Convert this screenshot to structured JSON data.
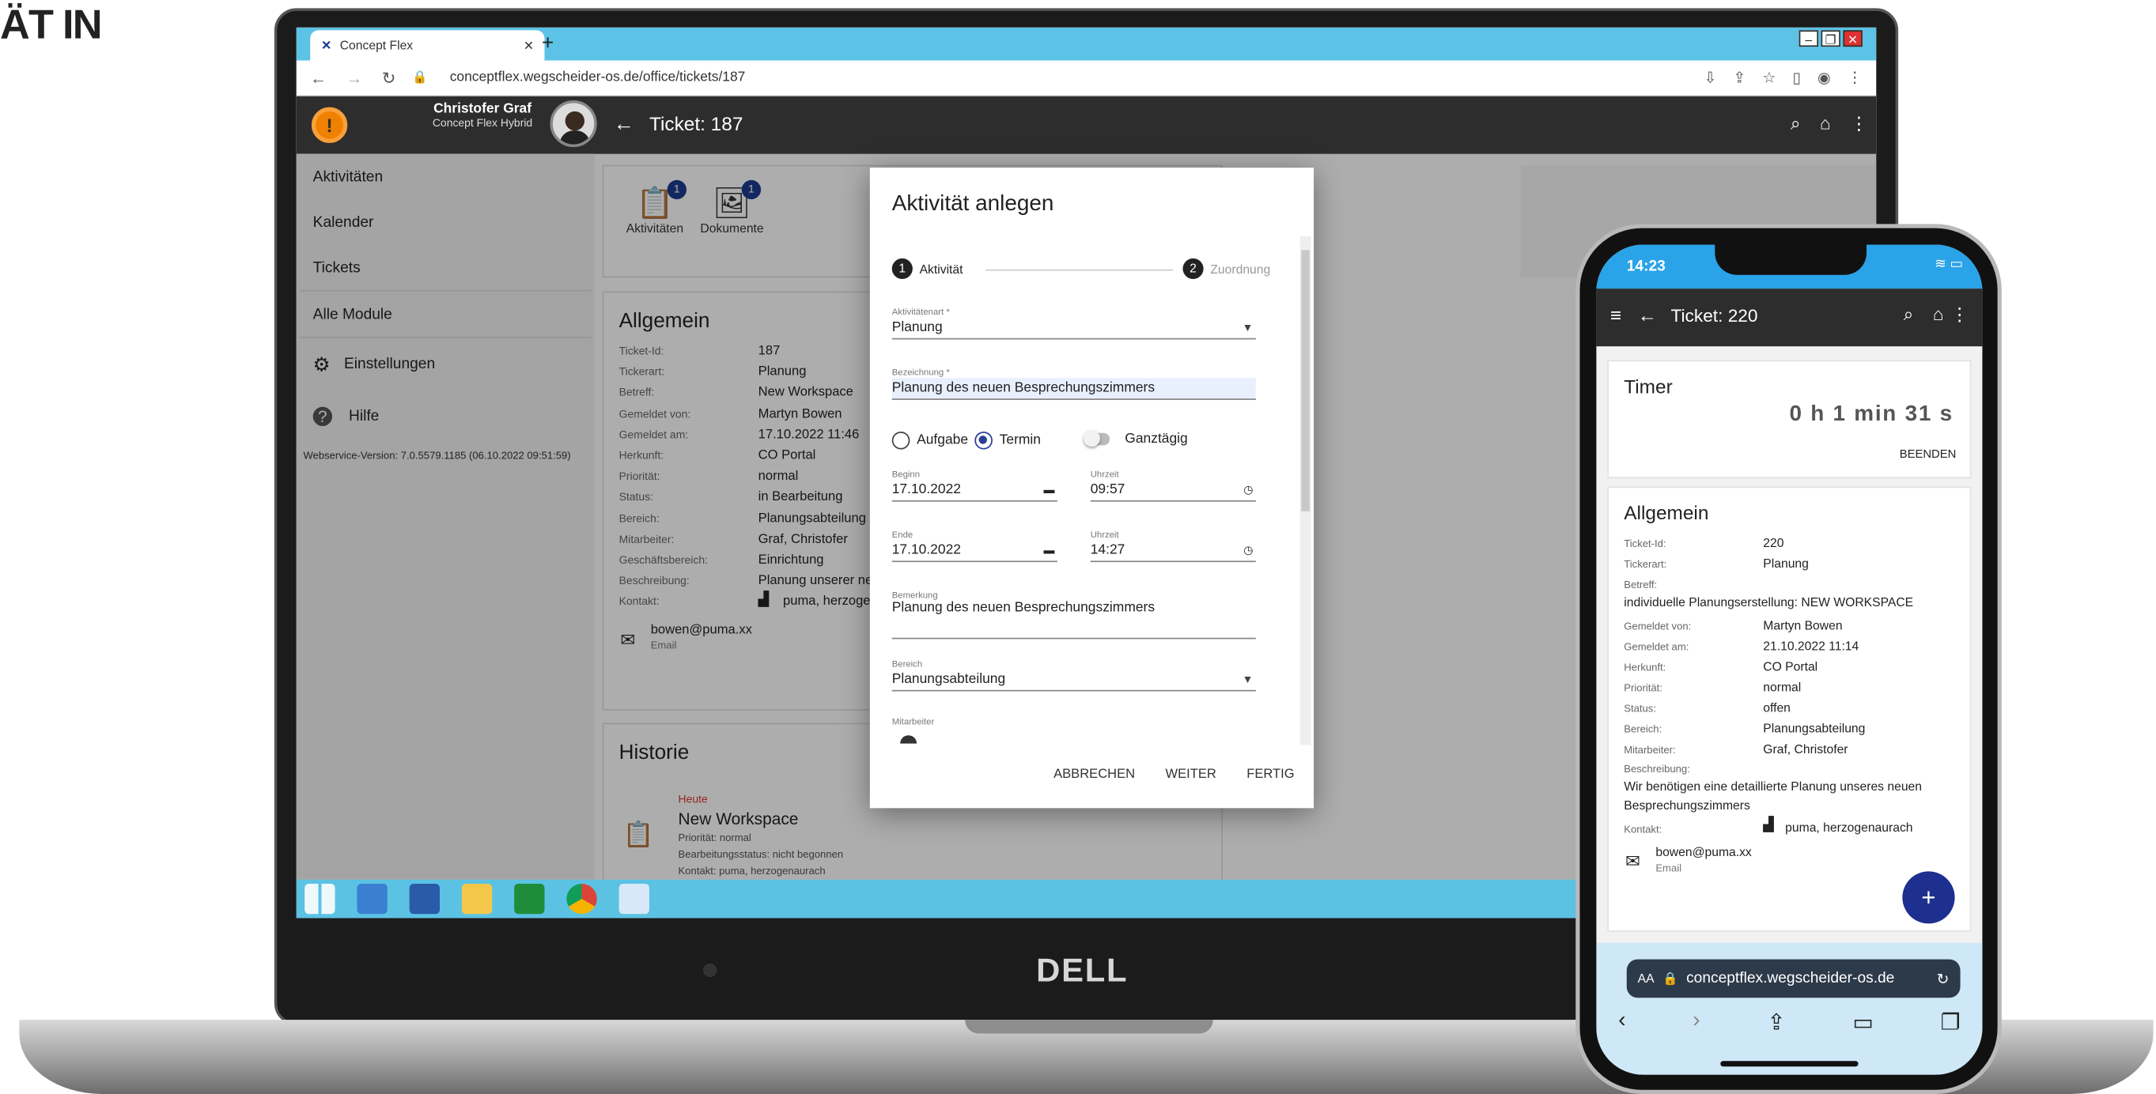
{
  "corner_text": "ÄT IN",
  "browser": {
    "tab_title": "Concept Flex",
    "url": "conceptflex.wegscheider-os.de/office/tickets/187"
  },
  "app": {
    "user_name": "Christofer Graf",
    "user_company": "Concept Flex Hybrid",
    "ticket_title": "Ticket: 187"
  },
  "sidebar": {
    "items": [
      "Aktivitäten",
      "Kalender",
      "Tickets",
      "Alle Module"
    ],
    "settings": "Einstellungen",
    "help": "Hilfe",
    "version": "Webservice-Version: 7.0.5579.1185 (06.10.2022 09:51:59)"
  },
  "chips": {
    "activities": "Aktivitäten",
    "activities_count": "1",
    "documents": "Dokumente",
    "documents_count": "1"
  },
  "general": {
    "title": "Allgemein",
    "rows": [
      {
        "k": "Ticket-Id:",
        "v": "187"
      },
      {
        "k": "Tickerart:",
        "v": "Planung"
      },
      {
        "k": "Betreff:",
        "v": "New Workspace"
      },
      {
        "k": "Gemeldet von:",
        "v": "Martyn Bowen"
      },
      {
        "k": "Gemeldet am:",
        "v": "17.10.2022 11:46"
      },
      {
        "k": "Herkunft:",
        "v": "CO Portal"
      },
      {
        "k": "Priorität:",
        "v": "normal"
      },
      {
        "k": "Status:",
        "v": "in Bearbeitung"
      },
      {
        "k": "Bereich:",
        "v": "Planungsabteilung"
      },
      {
        "k": "Mitarbeiter:",
        "v": "Graf, Christofer"
      },
      {
        "k": "Geschäftsbereich:",
        "v": "Einrichtung"
      },
      {
        "k": "Beschreibung:",
        "v": "Planung unserer ne"
      },
      {
        "k": "Kontakt:",
        "v": "puma, herzoge"
      }
    ],
    "email": "bowen@puma.xx",
    "email_label": "Email"
  },
  "history": {
    "title": "Historie",
    "today": "Heute",
    "entry_title": "New Workspace",
    "entry_lines": [
      "Priorität: normal",
      "Bearbeitungsstatus: nicht begonnen",
      "Kontakt: puma, herzogenaurach"
    ]
  },
  "dialog": {
    "title": "Aktivität anlegen",
    "step1": "Aktivität",
    "step2": "Zuordnung",
    "type_label": "Aktivitätenart *",
    "type_value": "Planung",
    "name_label": "Bezeichnung *",
    "name_value": "Planung des neuen Besprechungszimmers",
    "radio_task": "Aufgabe",
    "radio_appt": "Termin",
    "allday": "Ganztägig",
    "begin_label": "Beginn",
    "begin_date": "17.10.2022",
    "time_label": "Uhrzeit",
    "begin_time": "09:57",
    "end_label": "Ende",
    "end_date": "17.10.2022",
    "end_time": "14:27",
    "remark_label": "Bemerkung",
    "remark_value": "Planung des neuen Besprechungszimmers",
    "area_label": "Bereich",
    "area_value": "Planungsabteilung",
    "staff_label": "Mitarbeiter",
    "cancel": "ABBRECHEN",
    "next": "WEITER",
    "done": "FERTIG"
  },
  "laptop_brand": "DELL",
  "phone": {
    "time": "14:23",
    "ticket_title": "Ticket: 220",
    "timer_title": "Timer",
    "timer_value": "0 h 1 min 31 s",
    "timer_end": "BEENDEN",
    "general_title": "Allgemein",
    "rows": [
      {
        "k": "Ticket-Id:",
        "v": "220"
      },
      {
        "k": "Tickerart:",
        "v": "Planung"
      }
    ],
    "subject_label": "Betreff:",
    "subject_value": "individuelle Planungserstellung: NEW WORKSPACE",
    "rows2": [
      {
        "k": "Gemeldet von:",
        "v": "Martyn Bowen"
      },
      {
        "k": "Gemeldet am:",
        "v": "21.10.2022 11:14"
      },
      {
        "k": "Herkunft:",
        "v": "CO Portal"
      },
      {
        "k": "Priorität:",
        "v": "normal"
      },
      {
        "k": "Status:",
        "v": "offen"
      },
      {
        "k": "Bereich:",
        "v": "Planungsabteilung"
      },
      {
        "k": "Mitarbeiter:",
        "v": "Graf, Christofer"
      }
    ],
    "desc_label": "Beschreibung:",
    "desc_value": "Wir benötigen eine detaillierte Planung unseres neuen Besprechungszimmers",
    "contact_label": "Kontakt:",
    "contact_value": "puma, herzogenaurach",
    "email": "bowen@puma.xx",
    "email_label": "Email",
    "fab": "+",
    "safari_aa": "AA",
    "safari_url": "conceptflex.wegscheider-os.de"
  }
}
